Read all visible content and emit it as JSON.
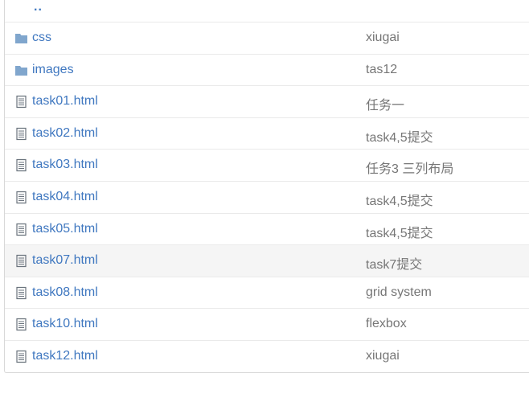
{
  "file_list": {
    "parent_link": "..",
    "entries": [
      {
        "type": "folder",
        "icon": "folder-icon",
        "name": "css",
        "message": "xiugai"
      },
      {
        "type": "folder",
        "icon": "folder-icon",
        "name": "images",
        "message": "tas12"
      },
      {
        "type": "file",
        "icon": "file-text-icon",
        "name": "task01.html",
        "message": "任务一"
      },
      {
        "type": "file",
        "icon": "file-text-icon",
        "name": "task02.html",
        "message": "task4,5提交"
      },
      {
        "type": "file",
        "icon": "file-text-icon",
        "name": "task03.html",
        "message": "任务3 三列布局"
      },
      {
        "type": "file",
        "icon": "file-text-icon",
        "name": "task04.html",
        "message": "task4,5提交"
      },
      {
        "type": "file",
        "icon": "file-text-icon",
        "name": "task05.html",
        "message": "task4,5提交"
      },
      {
        "type": "file",
        "icon": "file-text-icon",
        "name": "task07.html",
        "message": "task7提交"
      },
      {
        "type": "file",
        "icon": "file-text-icon",
        "name": "task08.html",
        "message": "grid system"
      },
      {
        "type": "file",
        "icon": "file-text-icon",
        "name": "task10.html",
        "message": "flexbox"
      },
      {
        "type": "file",
        "icon": "file-text-icon",
        "name": "task12.html",
        "message": "xiugai"
      }
    ]
  },
  "colors": {
    "link": "#4078c0",
    "message": "#767676",
    "folder_icon": "#80a6cd",
    "file_icon": "#6a737d",
    "hover_row": "#f5f5f5"
  }
}
